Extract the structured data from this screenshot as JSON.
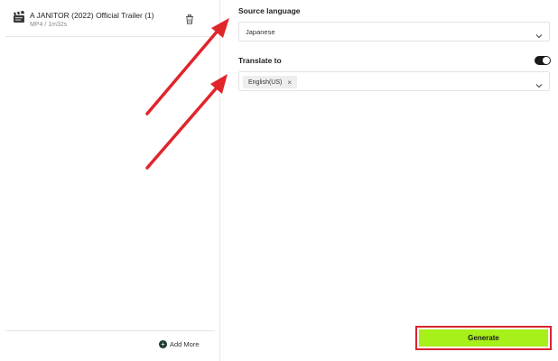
{
  "file": {
    "title": "A JANITOR (2022) Official Trailer (1)",
    "meta": "MP4 / 1m32s"
  },
  "left_footer": {
    "add_more_label": "Add More"
  },
  "source_language": {
    "label": "Source language",
    "value": "Japanese"
  },
  "translate_to": {
    "label": "Translate to",
    "toggle_on": true,
    "chips": [
      "English(US)"
    ]
  },
  "generate_label": "Generate",
  "colors": {
    "generate_bg": "#a7f019",
    "highlight_border": "#d9262b",
    "arrow": "#e0252b",
    "toggle": "#1a1a1a"
  },
  "icons": {
    "file": "clapperboard-icon",
    "trash": "trash-icon",
    "add": "plus-circle-icon",
    "chevron": "chevron-down-icon",
    "remove": "close-icon"
  }
}
